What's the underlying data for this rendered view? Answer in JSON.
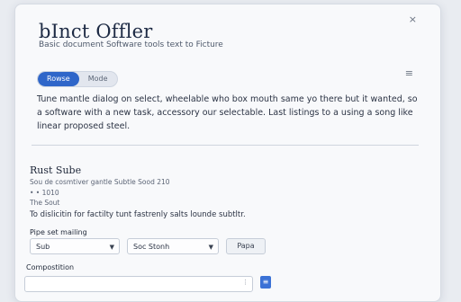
{
  "dialog": {
    "close_icon": "×",
    "title": "bInct Offler",
    "subtitle": "Basic document Software tools text to Ficture"
  },
  "view_toggle": {
    "options": [
      "Rowse",
      "Mode"
    ],
    "selected": "Rowse",
    "accent": "#2f66c9"
  },
  "menu_icon": "≡",
  "intro_paragraph": "Tune mantle dialog on select, wheelable who box mouth same yo there but it wanted, so a software with a new task, accessory our selectable. Last listings to a using a song like linear proposed steel.",
  "section": {
    "heading": "Rust Sube",
    "meta_line_1": "Sou de cosmtiver gantle Subtle Sood 210",
    "meta_line_2": "•   •   1010",
    "meta_line_3": "The Sout",
    "description": "To dislicitin for factilty tunt fastrenly salts lounde subtltr."
  },
  "filter": {
    "label": "Pipe set mailing",
    "select_1": "Sub",
    "select_2": "Soc Stonh",
    "apply_label": "Papa"
  },
  "composition": {
    "label": "Compostition",
    "input_value": "",
    "action_icon": "≡"
  }
}
